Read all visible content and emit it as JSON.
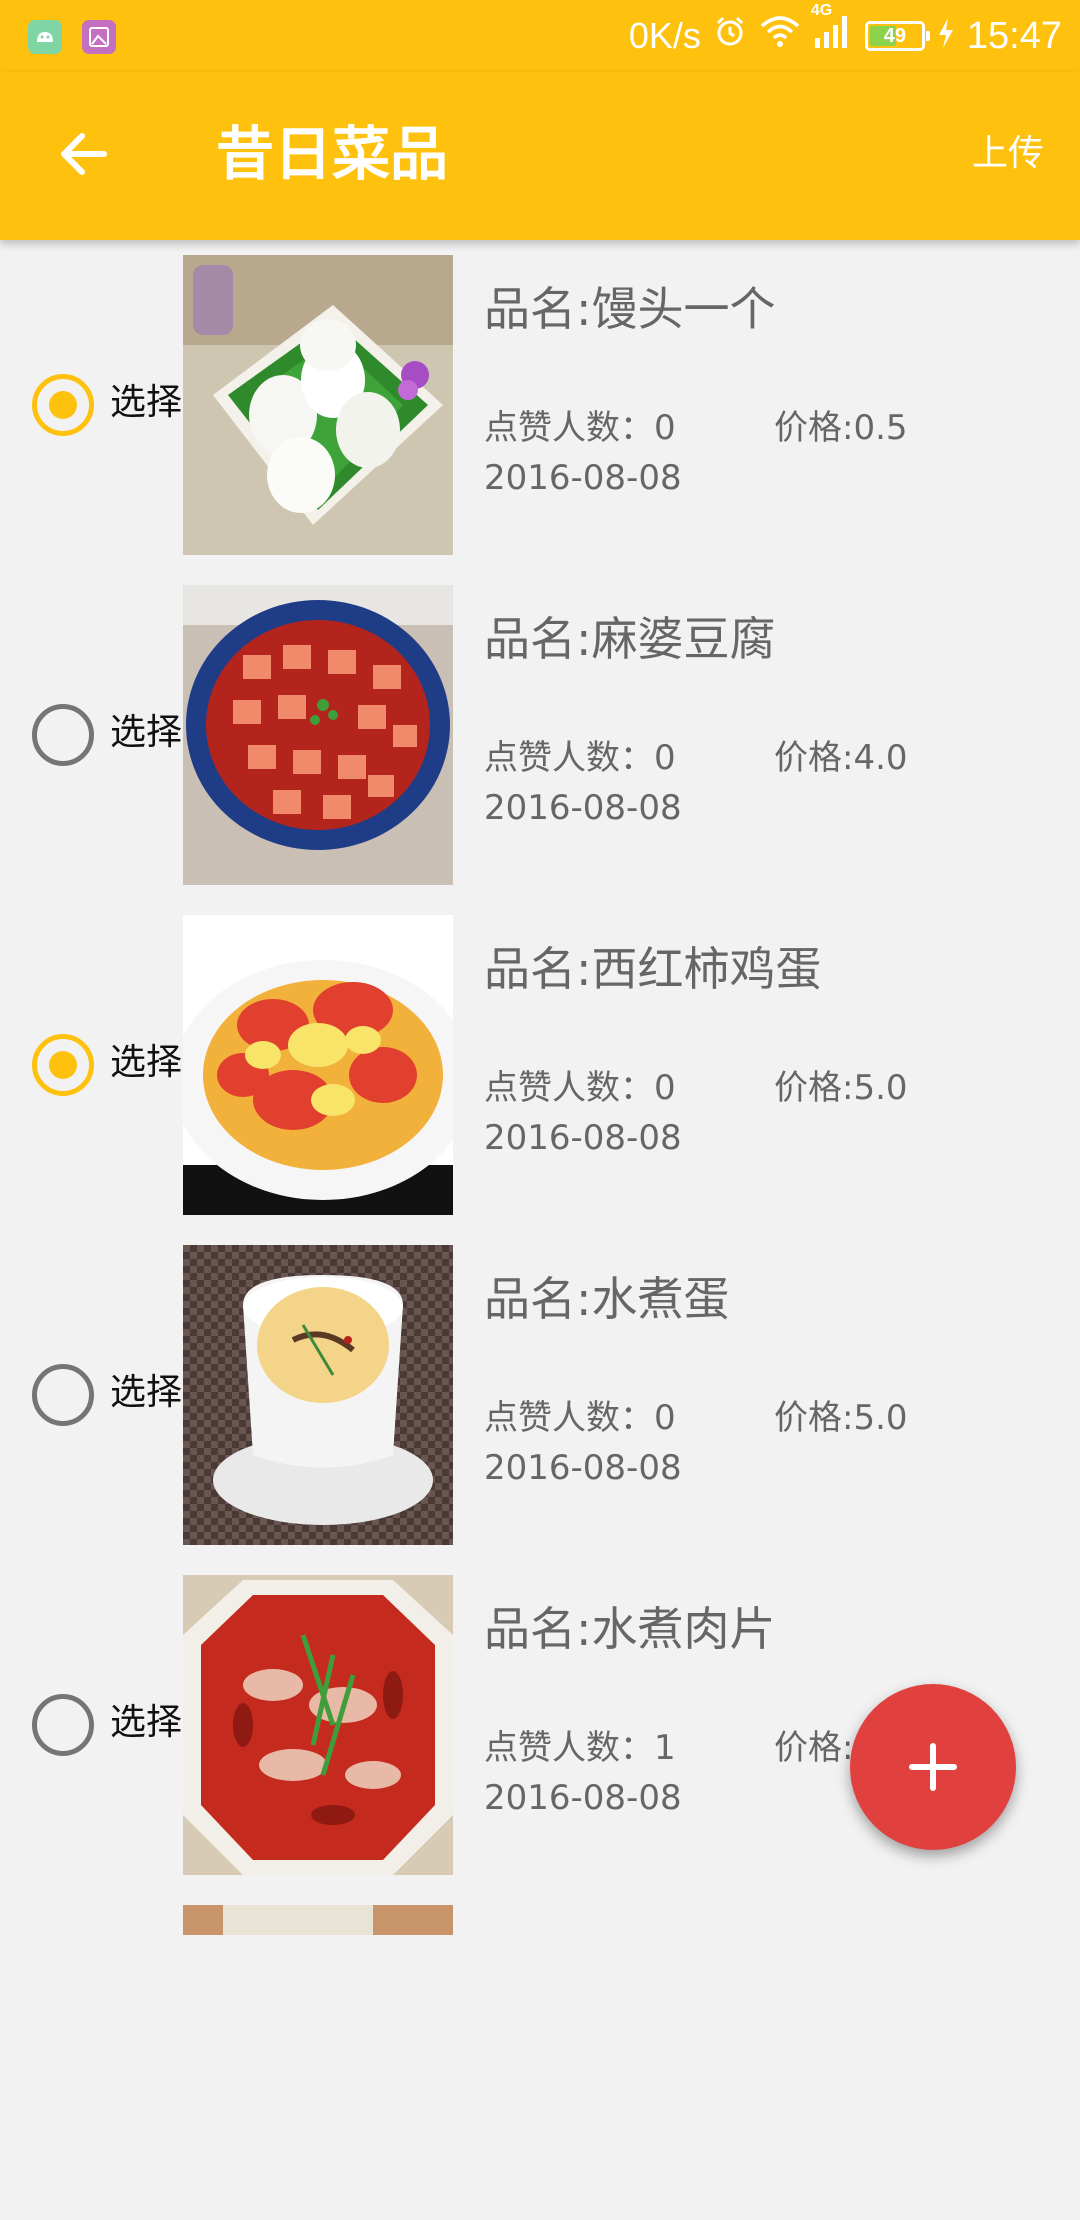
{
  "status_bar": {
    "left_icons": [
      "android-icon",
      "gallery-icon"
    ],
    "net_speed": "0K/s",
    "network_type": "4G",
    "battery_level": "49",
    "time": "15:47"
  },
  "app_bar": {
    "title": "昔日菜品",
    "action_label": "上传",
    "back_icon": "arrow-left-icon"
  },
  "colors": {
    "primary": "#fec10e",
    "fab": "#e0413e",
    "background": "#f2f2f2",
    "secondary_text": "#666666"
  },
  "dishes": [
    {
      "select_label": "选择",
      "selected": true,
      "name": "品名:馒头一个",
      "likes": "点赞人数：0",
      "price": "价格:0.5",
      "date": "2016-08-08"
    },
    {
      "select_label": "选择",
      "selected": false,
      "name": "品名:麻婆豆腐",
      "likes": "点赞人数：0",
      "price": "价格:4.0",
      "date": "2016-08-08"
    },
    {
      "select_label": "选择",
      "selected": true,
      "name": "品名:西红柿鸡蛋",
      "likes": "点赞人数：0",
      "price": "价格:5.0",
      "date": "2016-08-08"
    },
    {
      "select_label": "选择",
      "selected": false,
      "name": "品名:水煮蛋",
      "likes": "点赞人数：0",
      "price": "价格:5.0",
      "date": "2016-08-08"
    },
    {
      "select_label": "选择",
      "selected": false,
      "name": "品名:水煮肉片",
      "likes": "点赞人数：1",
      "price": "价格:",
      "date": "2016-08-08"
    }
  ],
  "fab": {
    "icon": "plus-icon"
  }
}
